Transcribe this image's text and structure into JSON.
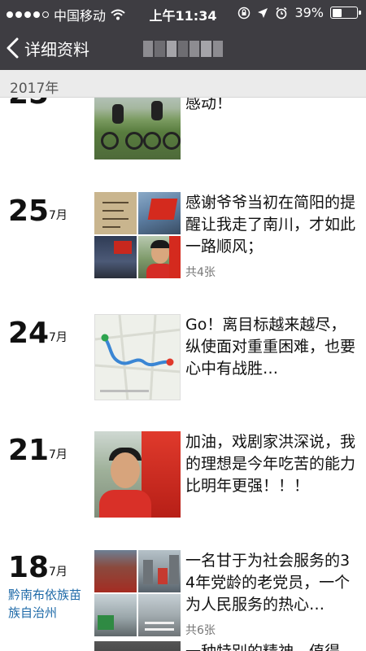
{
  "status_bar": {
    "carrier": "中国移动",
    "time": "上午11:34",
    "battery": "39%",
    "battery_level": 0.39,
    "icons": [
      "signal-dots-icon",
      "wifi-icon",
      "rotation-lock-icon",
      "location-icon",
      "alarm-icon",
      "battery-icon"
    ]
  },
  "nav": {
    "back_label": "详细资料",
    "title": ""
  },
  "year_header": "2017年",
  "entries": [
    {
      "day": "",
      "month": "",
      "text": "感动！",
      "count": "",
      "thumbs": [
        "cyclists-photo"
      ]
    },
    {
      "day": "25",
      "month": "7月",
      "text": "感谢爷爷当初在简阳的提醒让我走了南川，才如此一路顺风；",
      "count": "共4张",
      "thumbs": [
        "handwritten-note-photo",
        "flag-photo",
        "night-flag-photo",
        "portrait-photo"
      ]
    },
    {
      "day": "24",
      "month": "7月",
      "text": "Go！离目标越来越尽，纵使面对重重困难，也要心中有战胜…",
      "count": "",
      "thumbs": [
        "route-map"
      ]
    },
    {
      "day": "21",
      "month": "7月",
      "text": "加油，戏剧家洪深说，我的理想是今年吃苦的能力比明年更强！！！",
      "count": "",
      "thumbs": [
        "selfie-photo"
      ]
    },
    {
      "day": "18",
      "month": "7月",
      "location": "黔南布依族苗族自治州",
      "text": "一名甘于为社会服务的34年党龄的老党员，一个为人民服务的热心…",
      "count": "共6张",
      "thumbs": [
        "flag-photo",
        "street-photo",
        "bus-photo",
        "road-photo"
      ]
    },
    {
      "day": "",
      "month": "",
      "text": "一种特别的精神，值得",
      "count": "",
      "thumbs": [
        "dark-photo"
      ]
    }
  ]
}
